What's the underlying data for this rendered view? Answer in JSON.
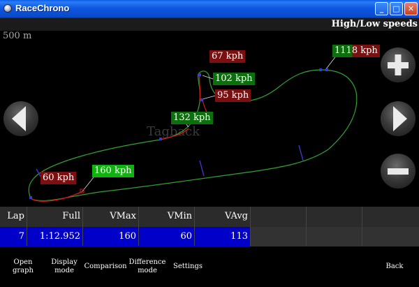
{
  "window": {
    "title": "RaceChrono",
    "minimize_label": "_",
    "maximize_label": "□",
    "close_label": "✕"
  },
  "header": {
    "speed_mode": "High/Low speeds"
  },
  "map": {
    "scale": "500 m",
    "watermark": "Tagback",
    "speed_labels": [
      {
        "text": "67 kph",
        "kind": "red"
      },
      {
        "text": "102 kph",
        "kind": "green"
      },
      {
        "text": "95 kph",
        "kind": "red"
      },
      {
        "text": "132 kph",
        "kind": "green"
      },
      {
        "text": "160 kph",
        "kind": "bright"
      },
      {
        "text": "60 kph",
        "kind": "red"
      },
      {
        "text": "1118 kph",
        "kind": "overlap"
      }
    ],
    "zoom_in_icon": "plus-icon",
    "zoom_out_icon": "minus-icon",
    "prev_icon": "triangle-left-icon",
    "next_icon": "triangle-right-icon"
  },
  "table": {
    "headers": [
      "Lap",
      "Full",
      "VMax",
      "VMin",
      "VAvg"
    ],
    "row": [
      "7",
      "1:12.952",
      "160",
      "60",
      "113"
    ]
  },
  "toolbar": {
    "open_graph": "Open graph",
    "display_mode": "Display mode",
    "comparison": "Comparison",
    "difference_mode": "Difference mode",
    "settings": "Settings",
    "back": "Back"
  },
  "colors": {
    "title_bar": "#0a5ee8",
    "table_highlight": "#0000c8",
    "track_green": "#2fa32f",
    "track_red": "#d01818",
    "label_red": "#7a1010",
    "label_green": "#0c6e0c",
    "label_bright_green": "#11b111"
  }
}
